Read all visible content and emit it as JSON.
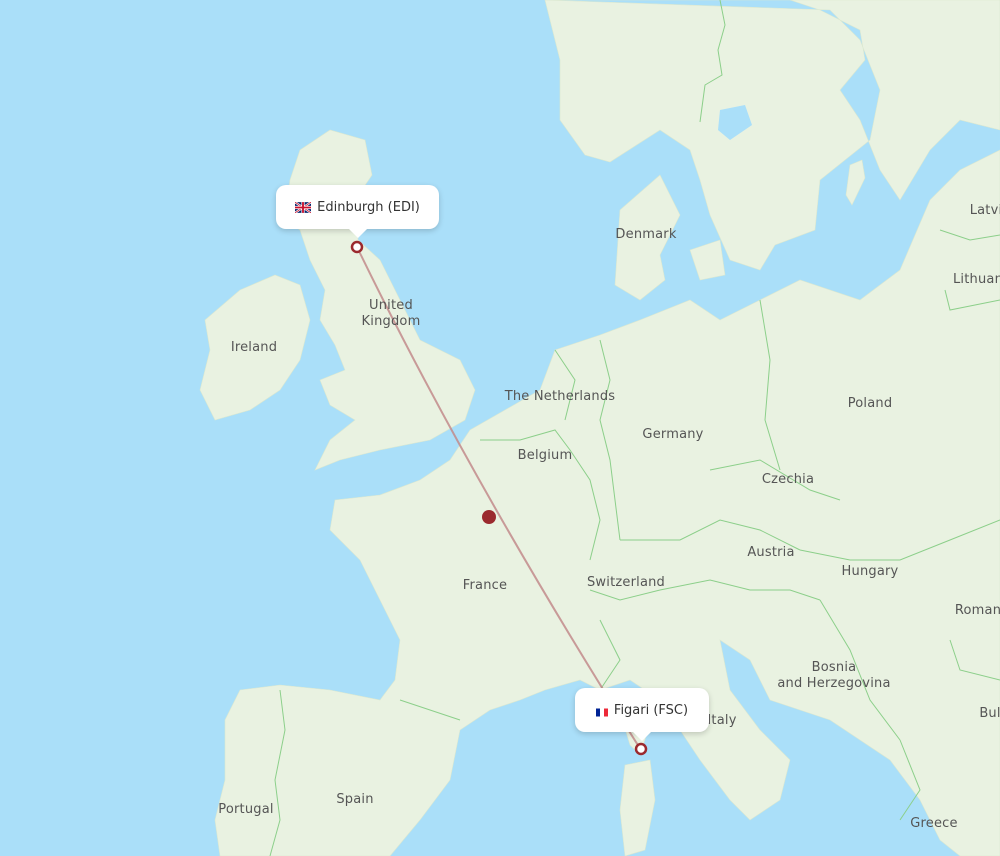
{
  "map": {
    "route": {
      "origin": {
        "city": "Edinburgh",
        "code": "EDI",
        "label": "Edinburgh (EDI)",
        "country_flag": "uk-flag-icon"
      },
      "destination": {
        "city": "Figari",
        "code": "FSC",
        "label": "Figari (FSC)",
        "country_flag": "france-flag-icon"
      },
      "line_color": "#c28b8b",
      "marker_color": "#9b2a2e"
    },
    "country_labels": [
      {
        "id": "united-kingdom",
        "text": "United\nKingdom"
      },
      {
        "id": "ireland",
        "text": "Ireland"
      },
      {
        "id": "denmark",
        "text": "Denmark"
      },
      {
        "id": "the-netherlands",
        "text": "The Netherlands"
      },
      {
        "id": "belgium",
        "text": "Belgium"
      },
      {
        "id": "germany",
        "text": "Germany"
      },
      {
        "id": "poland",
        "text": "Poland"
      },
      {
        "id": "czechia",
        "text": "Czechia"
      },
      {
        "id": "austria",
        "text": "Austria"
      },
      {
        "id": "hungary",
        "text": "Hungary"
      },
      {
        "id": "switzerland",
        "text": "Switzerland"
      },
      {
        "id": "france",
        "text": "France"
      },
      {
        "id": "italy",
        "text": "Italy"
      },
      {
        "id": "bosnia",
        "text": "Bosnia\nand Herzegovina"
      },
      {
        "id": "spain",
        "text": "Spain"
      },
      {
        "id": "portugal",
        "text": "Portugal"
      },
      {
        "id": "greece",
        "text": "Greece"
      },
      {
        "id": "latvia",
        "text": "Latvi"
      },
      {
        "id": "lithuania",
        "text": "Lithuan"
      },
      {
        "id": "romania",
        "text": "Roman"
      },
      {
        "id": "bulgaria",
        "text": "Bul"
      }
    ],
    "colors": {
      "water": "#aadff9",
      "land": "#e9f2e1",
      "border": "#8ccf8a",
      "label": "#555555"
    }
  }
}
